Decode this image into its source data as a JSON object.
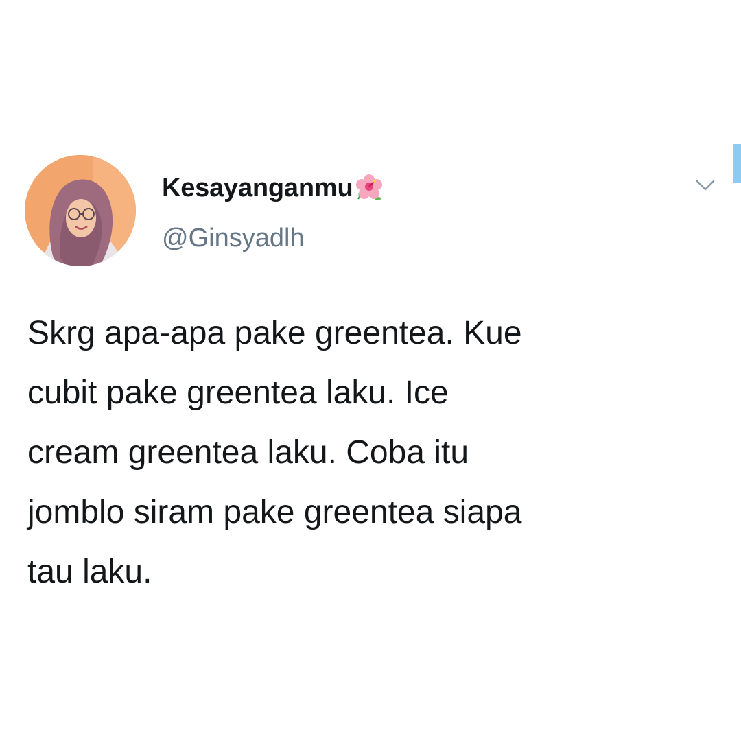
{
  "tweet": {
    "display_name": "Kesayanganmu",
    "name_emoji_icon": "hibiscus-flower-icon",
    "handle": "@Ginsyadlh",
    "text": "Skrg apa-apa pake greentea. Kue\ncubit pake greentea laku. Ice\ncream greentea laku. Coba itu\njomblo siram pake greentea siapa\ntau laku.",
    "menu_icon": "chevron-down-icon"
  },
  "colors": {
    "text_primary": "#14171a",
    "text_secondary": "#657786",
    "accent": "#8ecbf2",
    "background": "#ffffff"
  }
}
